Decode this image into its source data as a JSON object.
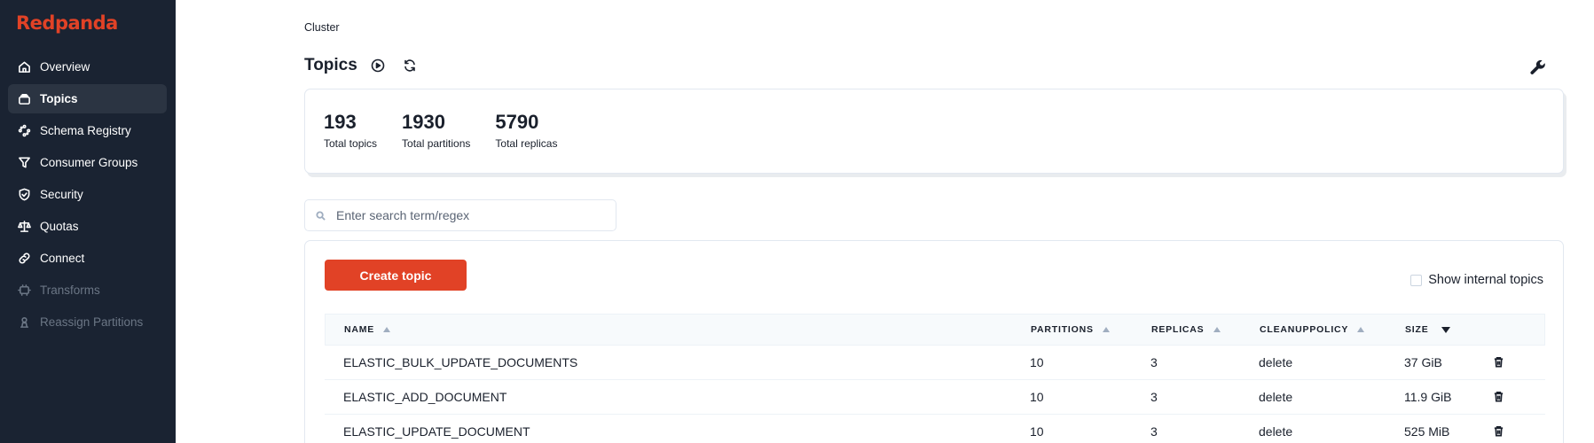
{
  "brand": {
    "logo": "Redpanda",
    "color": "#e14226"
  },
  "sidebar": {
    "items": [
      {
        "label": "Overview",
        "icon": "home-icon",
        "state": "normal"
      },
      {
        "label": "Topics",
        "icon": "topics-icon",
        "state": "active"
      },
      {
        "label": "Schema Registry",
        "icon": "schema-icon",
        "state": "normal"
      },
      {
        "label": "Consumer Groups",
        "icon": "funnel-icon",
        "state": "normal"
      },
      {
        "label": "Security",
        "icon": "shield-icon",
        "state": "normal"
      },
      {
        "label": "Quotas",
        "icon": "scale-icon",
        "state": "normal"
      },
      {
        "label": "Connect",
        "icon": "link-icon",
        "state": "normal"
      },
      {
        "label": "Transforms",
        "icon": "transform-icon",
        "state": "disabled"
      },
      {
        "label": "Reassign Partitions",
        "icon": "reassign-icon",
        "state": "disabled"
      }
    ]
  },
  "header": {
    "breadcrumb": "Cluster",
    "title": "Topics",
    "actions": [
      "play-icon",
      "refresh-icon"
    ],
    "settings_icon": "wrench-icon"
  },
  "stats": [
    {
      "value": "193",
      "label": "Total topics"
    },
    {
      "value": "1930",
      "label": "Total partitions"
    },
    {
      "value": "5790",
      "label": "Total replicas"
    }
  ],
  "search": {
    "placeholder": "Enter search term/regex",
    "value": ""
  },
  "toolbar": {
    "create_label": "Create topic",
    "internal_label": "Show internal topics",
    "internal_checked": false
  },
  "table": {
    "columns": [
      "NAME",
      "PARTITIONS",
      "REPLICAS",
      "CLEANUPPOLICY",
      "SIZE"
    ],
    "sort": {
      "column": "SIZE",
      "direction": "desc"
    },
    "rows": [
      {
        "name": "ELASTIC_BULK_UPDATE_DOCUMENTS",
        "partitions": "10",
        "replicas": "3",
        "cleanup": "delete",
        "size": "37 GiB"
      },
      {
        "name": "ELASTIC_ADD_DOCUMENT",
        "partitions": "10",
        "replicas": "3",
        "cleanup": "delete",
        "size": "11.9 GiB"
      },
      {
        "name": "ELASTIC_UPDATE_DOCUMENT",
        "partitions": "10",
        "replicas": "3",
        "cleanup": "delete",
        "size": "525 MiB"
      }
    ]
  }
}
